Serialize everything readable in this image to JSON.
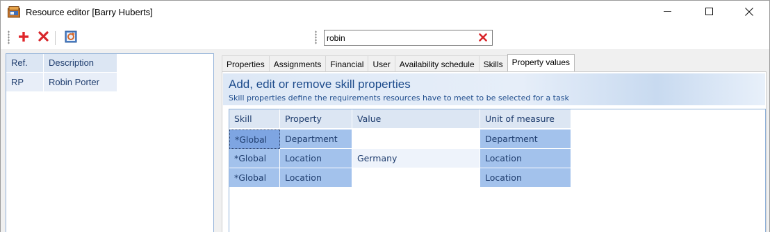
{
  "window": {
    "title": "Resource editor [Barry Huberts]",
    "icons": {
      "app": "resource-editor-app-icon",
      "minimize": "minimize-icon",
      "maximize": "maximize-icon",
      "close": "close-icon"
    }
  },
  "toolbar": {
    "icons": {
      "add": "plus-icon",
      "delete": "delete-x-icon",
      "refresh": "refresh-icon"
    },
    "search": {
      "value": "robin",
      "placeholder": "",
      "clear_icon": "clear-x-icon"
    }
  },
  "resource_list": {
    "columns": [
      "Ref.",
      "Description"
    ],
    "rows": [
      {
        "ref": "RP",
        "description": "Robin Porter"
      }
    ]
  },
  "tabs": [
    {
      "label": "Properties",
      "active": false
    },
    {
      "label": "Assignments",
      "active": false
    },
    {
      "label": "Financial",
      "active": false
    },
    {
      "label": "User",
      "active": false
    },
    {
      "label": "Availability schedule",
      "active": false
    },
    {
      "label": "Skills",
      "active": false
    },
    {
      "label": "Property values",
      "active": true
    }
  ],
  "panel": {
    "title": "Add, edit or remove skill properties",
    "subtitle": "Skill properties define the requirements resources have to meet to be selected for a task"
  },
  "property_grid": {
    "columns": [
      "Skill",
      "Property",
      "Value",
      "Unit of measure"
    ],
    "rows": [
      {
        "skill": "*Global",
        "property": "Department",
        "value": "",
        "unit": "Department"
      },
      {
        "skill": "*Global",
        "property": "Location",
        "value": "Germany",
        "unit": "Location"
      },
      {
        "skill": "*Global",
        "property": "Location",
        "value": "",
        "unit": "Location"
      }
    ]
  },
  "colors": {
    "header_bg": "#dce6f3",
    "header_text": "#1f3d6e",
    "cell_blue": "#a3c2ec",
    "selected_cell": "#7ea5e2",
    "banner_text": "#1e4c8c",
    "add_red": "#e0262b"
  }
}
